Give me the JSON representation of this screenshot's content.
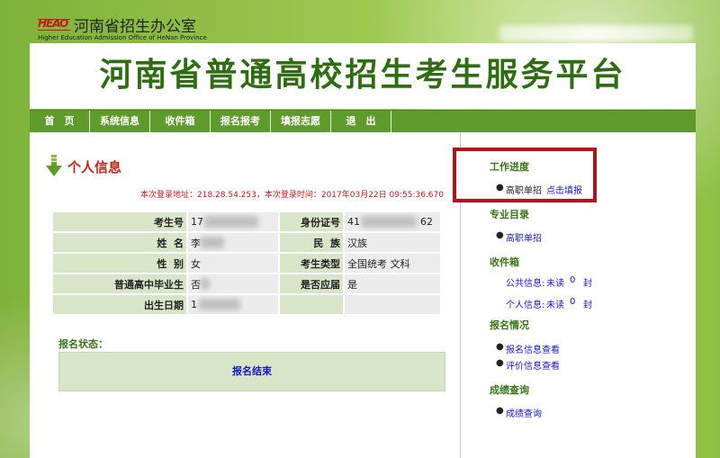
{
  "header": {
    "logo_mark": "HEAO",
    "org_name": "河南省招生办公室",
    "org_subtitle": "Higher Education Admission Office of HeNan Province",
    "banner_title": "河南省普通高校招生考生服务平台"
  },
  "nav": {
    "items": [
      "首　页",
      "系统信息",
      "收件箱",
      "报名报考",
      "填报志愿",
      "退　出"
    ]
  },
  "profile": {
    "section_title": "个人信息",
    "login_info": "本次登录地址：218.28.54.253，本次登录时间：2017年03月22日 09:55:36.670",
    "labels": {
      "exam_no": "考生号",
      "id_no": "身份证号",
      "name": "姓  名",
      "ethnicity": "民  族",
      "gender": "性  别",
      "exam_type": "考生类型",
      "hs_grad": "普通高中毕业生",
      "is_current": "是否应届",
      "birth_date": "出生日期"
    },
    "values": {
      "exam_no": "17",
      "id_no_prefix": "41",
      "id_no_suffix": "62",
      "name": "李",
      "ethnicity": "汉族",
      "gender": "女",
      "exam_type": "全国统考 文科",
      "hs_grad": "否",
      "is_current": "是",
      "birth_date": "1"
    },
    "status_label": "报名状态：",
    "status_value": "报名结束"
  },
  "sidebar": {
    "progress": {
      "title": "工作进度",
      "item": "高职单招",
      "link": "点击填报"
    },
    "majors": {
      "title": "专业目录",
      "item": "高职单招"
    },
    "inbox": {
      "title": "收件箱",
      "public_label": "公共信息:",
      "public_status": "未读",
      "public_count": "0",
      "public_unit": "封",
      "personal_label": "个人信息:",
      "personal_status": "未读",
      "personal_count": "0",
      "personal_unit": "封"
    },
    "registration": {
      "title": "报名情况",
      "item1": "报名信息查看",
      "item2": "评价信息查看"
    },
    "scores": {
      "title": "成绩查询",
      "item": "成绩查询"
    }
  }
}
